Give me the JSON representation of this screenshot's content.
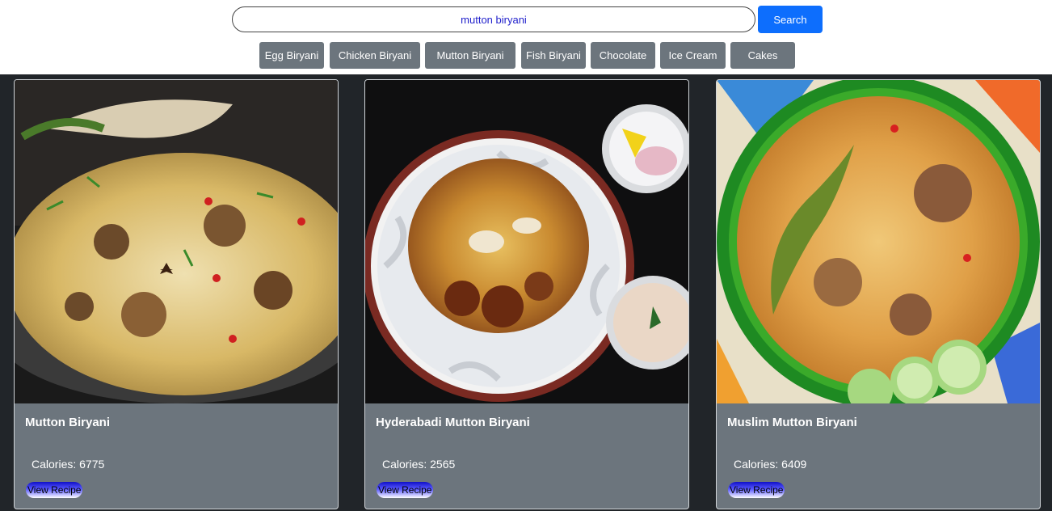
{
  "search": {
    "value": "mutton biryani",
    "button_label": "Search"
  },
  "categories": [
    "Egg Biryani",
    "Chicken Biryani",
    "Mutton Biryani",
    "Fish Biryani",
    "Chocolate",
    "Ice Cream",
    "Cakes"
  ],
  "cards": [
    {
      "title": "Mutton Biryani",
      "calories": "Calories: 6775",
      "button_label": "View Recipe"
    },
    {
      "title": "Hyderabadi Mutton Biryani",
      "calories": "Calories: 2565",
      "button_label": "View Recipe"
    },
    {
      "title": "Muslim Mutton Biryani",
      "calories": "Calories: 6409",
      "button_label": "View Recipe"
    }
  ],
  "colors": {
    "primary_button": "#0d6efd",
    "category_button": "#6c757d",
    "content_background": "#212529",
    "card_background": "#6c757d"
  }
}
